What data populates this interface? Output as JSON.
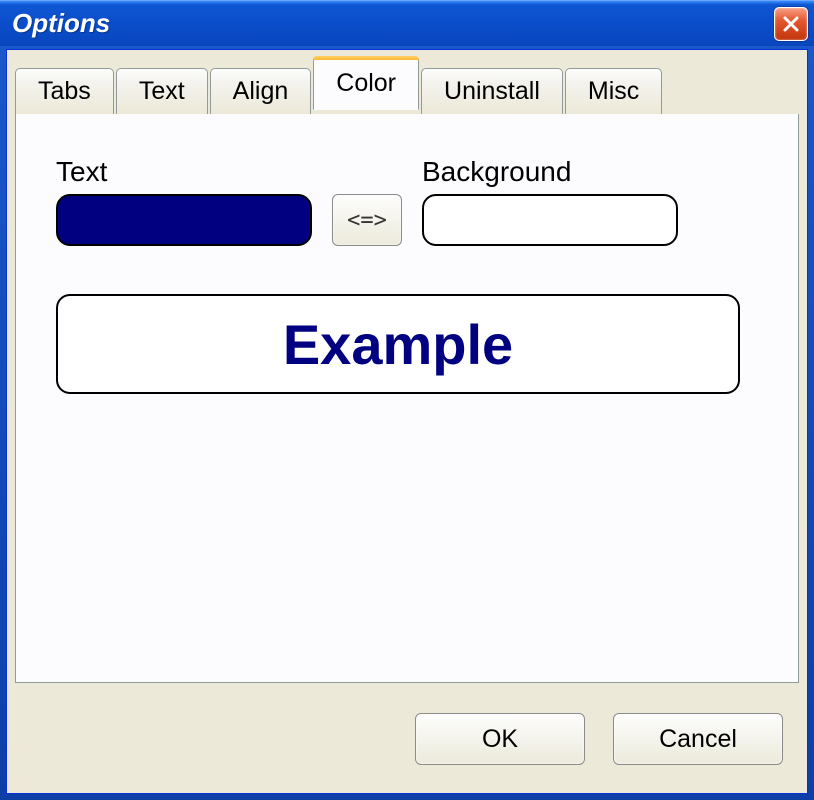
{
  "window": {
    "title": "Options"
  },
  "tabs": [
    {
      "label": "Tabs",
      "active": false
    },
    {
      "label": "Text",
      "active": false
    },
    {
      "label": "Align",
      "active": false
    },
    {
      "label": "Color",
      "active": true
    },
    {
      "label": "Uninstall",
      "active": false
    },
    {
      "label": "Misc",
      "active": false
    }
  ],
  "color_panel": {
    "text_label": "Text",
    "background_label": "Background",
    "swap_label": "<=>",
    "text_color": "#000080",
    "background_color": "#ffffff",
    "example_text": "Example"
  },
  "buttons": {
    "ok": "OK",
    "cancel": "Cancel"
  }
}
